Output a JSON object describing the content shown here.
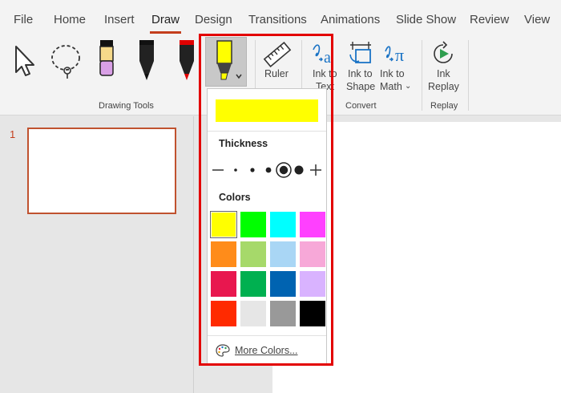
{
  "tabs": [
    "File",
    "Home",
    "Insert",
    "Draw",
    "Design",
    "Transitions",
    "Animations",
    "Slide Show",
    "Review",
    "View"
  ],
  "active_tab": "Draw",
  "ribbon": {
    "groups": {
      "drawing_tools": "Drawing Tools",
      "convert": "Convert",
      "replay": "Replay"
    },
    "ruler_label": "Ruler",
    "ink_to_text_line1": "Ink to",
    "ink_to_text_line2": "Text",
    "ink_to_shape_line1": "Ink to",
    "ink_to_shape_line2": "Shape",
    "ink_to_math_line1": "Ink to",
    "ink_to_math_line2": "Math",
    "ink_replay_line1": "Ink",
    "ink_replay_line2": "Replay",
    "icons": [
      "select-arrow-icon",
      "lasso-select-icon",
      "eraser-icon",
      "black-pen-icon",
      "red-pen-icon",
      "highlighter-icon",
      "ruler-icon",
      "ink-to-text-icon",
      "ink-to-shape-icon",
      "ink-to-math-icon",
      "ink-replay-icon"
    ]
  },
  "slides_panel": {
    "slide_number": "1"
  },
  "dropdown": {
    "thickness_label": "Thickness",
    "colors_label": "Colors",
    "more_colors_label": "More Colors...",
    "selected_color": "#ffff00",
    "colors": [
      "#ffff00",
      "#00ff00",
      "#00ffff",
      "#ff40ff",
      "#ff8c1a",
      "#a6d96a",
      "#a9d6f5",
      "#f7a8d8",
      "#e8174f",
      "#00b050",
      "#0063b1",
      "#d9b3ff",
      "#ff2a00",
      "#e6e6e6",
      "#999999",
      "#000000"
    ]
  },
  "accent_color": "#c43e1c",
  "highlight_outline_color": "#e30000"
}
